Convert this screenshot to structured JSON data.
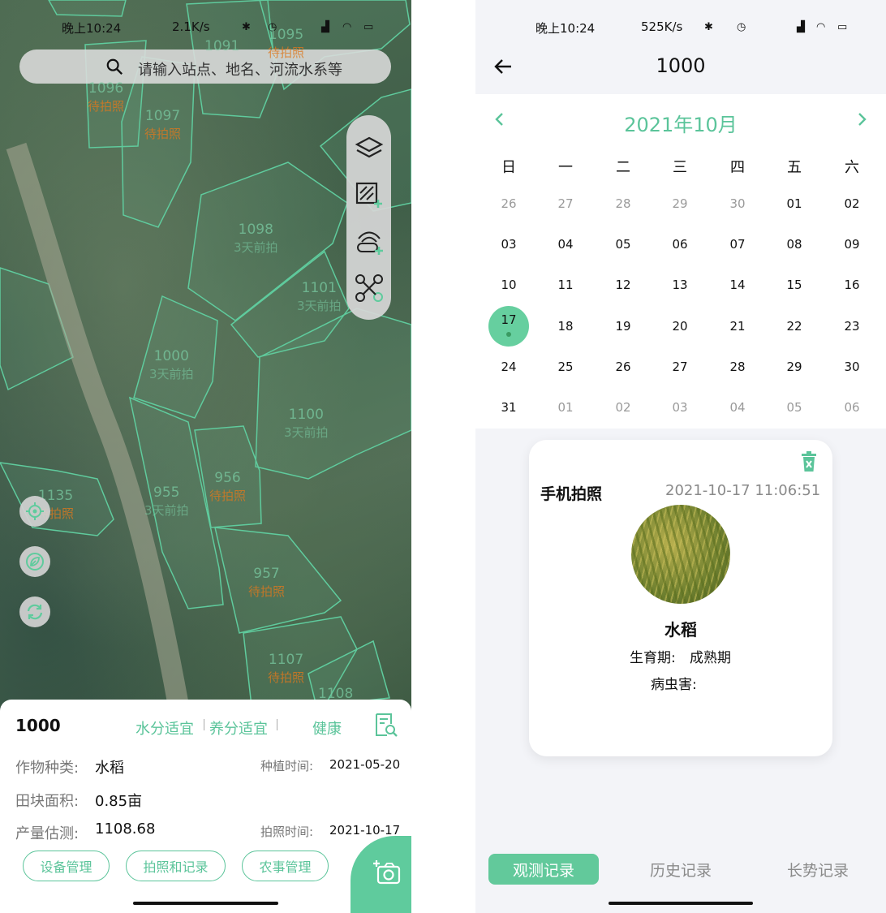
{
  "left": {
    "status": {
      "time": "晚上10:24",
      "speed": "2.1K/s"
    },
    "search": {
      "placeholder": "请输入站点、地名、河流水系等"
    },
    "plots": [
      {
        "id": "1096",
        "status": "待拍照",
        "kind": "orange"
      },
      {
        "id": "1097",
        "status": "待拍照",
        "kind": "orange"
      },
      {
        "id": "1098",
        "status": "3天前拍",
        "kind": "green"
      },
      {
        "id": "1101",
        "status": "3天前拍",
        "kind": "green"
      },
      {
        "id": "1000",
        "status": "3天前拍",
        "kind": "green"
      },
      {
        "id": "1100",
        "status": "3天前拍",
        "kind": "green"
      },
      {
        "id": "956",
        "status": "待拍照",
        "kind": "orange"
      },
      {
        "id": "955",
        "status": "3天前拍",
        "kind": "green"
      },
      {
        "id": "1135",
        "status": "待拍照",
        "kind": "orange"
      },
      {
        "id": "957",
        "status": "待拍照",
        "kind": "orange"
      },
      {
        "id": "1107",
        "status": "待拍照",
        "kind": "orange"
      },
      {
        "id": "1108",
        "status": "",
        "kind": "green"
      },
      {
        "id": "1091",
        "status": "",
        "kind": "green"
      },
      {
        "id": "1095",
        "status": "待拍照",
        "kind": "orange"
      }
    ],
    "sheet": {
      "plot_id": "1000",
      "tags": [
        "水分适宜",
        "养分适宜",
        "健康"
      ],
      "crop_label": "作物种类:",
      "crop_value": "水稻",
      "plant_time_label": "种植时间:",
      "plant_time_value": "2021-05-20",
      "area_label": "田块面积:",
      "area_value": "0.85亩",
      "yield_label": "产量估测:",
      "yield_value": "1108.68",
      "photo_time_label": "拍照时间:",
      "photo_time_value": "2021-10-17",
      "buttons": [
        "设备管理",
        "拍照和记录",
        "农事管理"
      ]
    }
  },
  "right": {
    "status": {
      "time": "晚上10:24",
      "speed": "525K/s"
    },
    "title": "1000",
    "calendar": {
      "month": "2021年10月",
      "weekdays": [
        "日",
        "一",
        "二",
        "三",
        "四",
        "五",
        "六"
      ],
      "days": [
        [
          "26",
          "27",
          "28",
          "29",
          "30",
          "01",
          "02"
        ],
        [
          "03",
          "04",
          "05",
          "06",
          "07",
          "08",
          "09"
        ],
        [
          "10",
          "11",
          "12",
          "13",
          "14",
          "15",
          "16"
        ],
        [
          "17",
          "18",
          "19",
          "20",
          "21",
          "22",
          "23"
        ],
        [
          "24",
          "25",
          "26",
          "27",
          "28",
          "29",
          "30"
        ],
        [
          "31",
          "01",
          "02",
          "03",
          "04",
          "05",
          "06"
        ]
      ],
      "selected": "17"
    },
    "card": {
      "title": "手机拍照",
      "time": "2021-10-17 11:06:51",
      "crop": "水稻",
      "growth_label": "生育期:",
      "growth_value": "成熟期",
      "pest_label": "病虫害:",
      "pest_value": ""
    },
    "tabs": [
      "观测记录",
      "历史记录",
      "长势记录"
    ],
    "active_tab": 0
  },
  "colors": {
    "accent": "#5bc49a",
    "orange": "#dc781e"
  }
}
